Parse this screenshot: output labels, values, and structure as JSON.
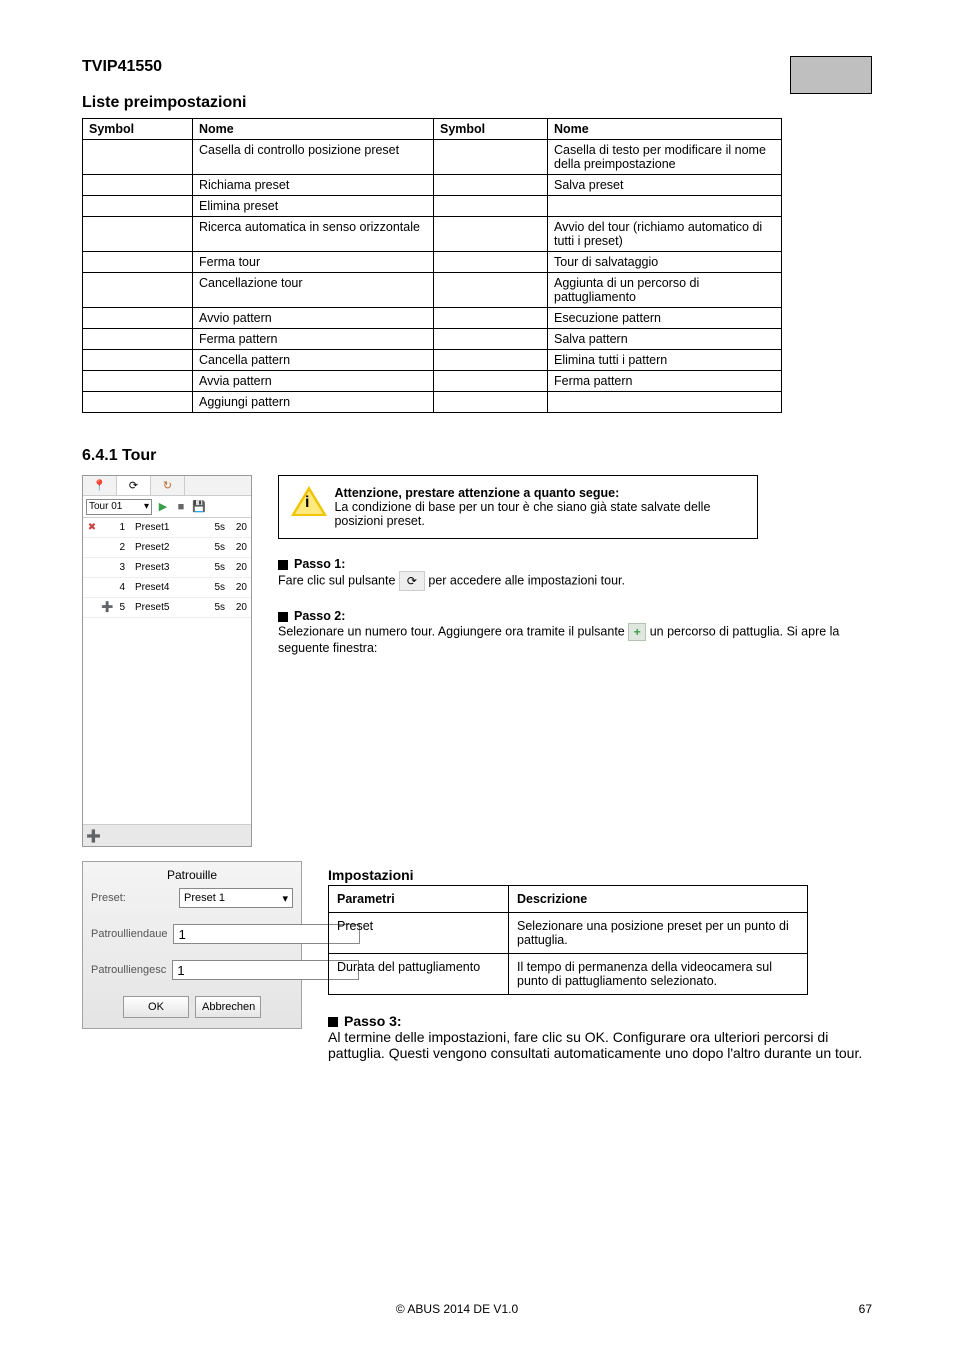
{
  "model": "TVIP41550",
  "preset_table": {
    "title": "Liste preimpostazioni",
    "headers": [
      "Symbol",
      "Nome",
      "Symbol",
      "Nome"
    ],
    "rows": [
      [
        "",
        "Casella di controllo posizione preset",
        "",
        "Casella di testo per modificare il nome della preimpostazione"
      ],
      [
        "",
        "Richiama preset",
        "",
        "Salva preset"
      ],
      [
        "",
        "Elimina preset",
        "",
        ""
      ],
      [
        "",
        "Ricerca automatica in senso orizzontale",
        "",
        "Avvio del tour (richiamo automatico di tutti i preset)"
      ],
      [
        "",
        "Ferma tour",
        "",
        "Tour di salvataggio"
      ],
      [
        "",
        "Cancellazione tour",
        "",
        "Aggiunta di un percorso di pattugliamento"
      ],
      [
        "",
        "Avvio pattern",
        "",
        "Esecuzione pattern"
      ],
      [
        "",
        "Ferma pattern",
        "",
        "Salva pattern"
      ],
      [
        "",
        "Cancella pattern",
        "",
        "Elimina tutti i pattern"
      ],
      [
        "",
        "Avvia pattern",
        "",
        "Ferma pattern"
      ],
      [
        "",
        "Aggiungi pattern",
        "",
        ""
      ]
    ]
  },
  "tour_panel": {
    "section": "6.4.1 Tour",
    "tour_select": "Tour 01",
    "rows": [
      {
        "idx": "1",
        "name": "Preset1",
        "dur": "5s",
        "spd": "20",
        "del": true
      },
      {
        "idx": "2",
        "name": "Preset2",
        "dur": "5s",
        "spd": "20"
      },
      {
        "idx": "3",
        "name": "Preset3",
        "dur": "5s",
        "spd": "20"
      },
      {
        "idx": "4",
        "name": "Preset4",
        "dur": "5s",
        "spd": "20"
      },
      {
        "idx": "5",
        "name": "Preset5",
        "dur": "5s",
        "spd": "20",
        "add": true
      }
    ]
  },
  "warning": {
    "title": "Attenzione, prestare attenzione a quanto segue:",
    "body": "La condizione di base per un tour è che siano già state salvate delle posizioni preset."
  },
  "steps": {
    "step1_label": "Passo 1:",
    "step1_body": "Fare clic sul pulsante         per accedere alle impostazioni tour.",
    "step2_label": "Passo 2:",
    "step2_body_pre": "Selezionare un numero tour. Aggiungere ora tramite il pulsante       un percorso di pattuglia. Si apre la seguente finestra:",
    "step3_label": "Passo 3:",
    "step3_body": "Al termine delle impostazioni, fare clic su OK. Configurare ora ulteriori percorsi di pattuglia. Questi vengono consultati automaticamente uno dopo l'altro durante un tour."
  },
  "param_table": {
    "headers": [
      "Parametri",
      "Descrizione"
    ],
    "rows": [
      [
        "Preset",
        "Selezionare una posizione preset per un punto di pattuglia."
      ],
      [
        "Durata del pattugliamento",
        "Il tempo di permanenza della videocamera sul punto di pattugliamento selezionato."
      ]
    ]
  },
  "dialog": {
    "title": "Patrouille",
    "set_hdr": "Impostazioni",
    "preset_label": "Preset:",
    "preset_value": "Preset 1",
    "dur_label": "Patroulliendaue",
    "dur_value": "1",
    "spd_label": "Patroulliengesc",
    "spd_value": "1",
    "ok": "OK",
    "cancel": "Abbrechen"
  },
  "footer": {
    "copy": "© ABUS 2014 DE V1.0",
    "page": "67"
  }
}
